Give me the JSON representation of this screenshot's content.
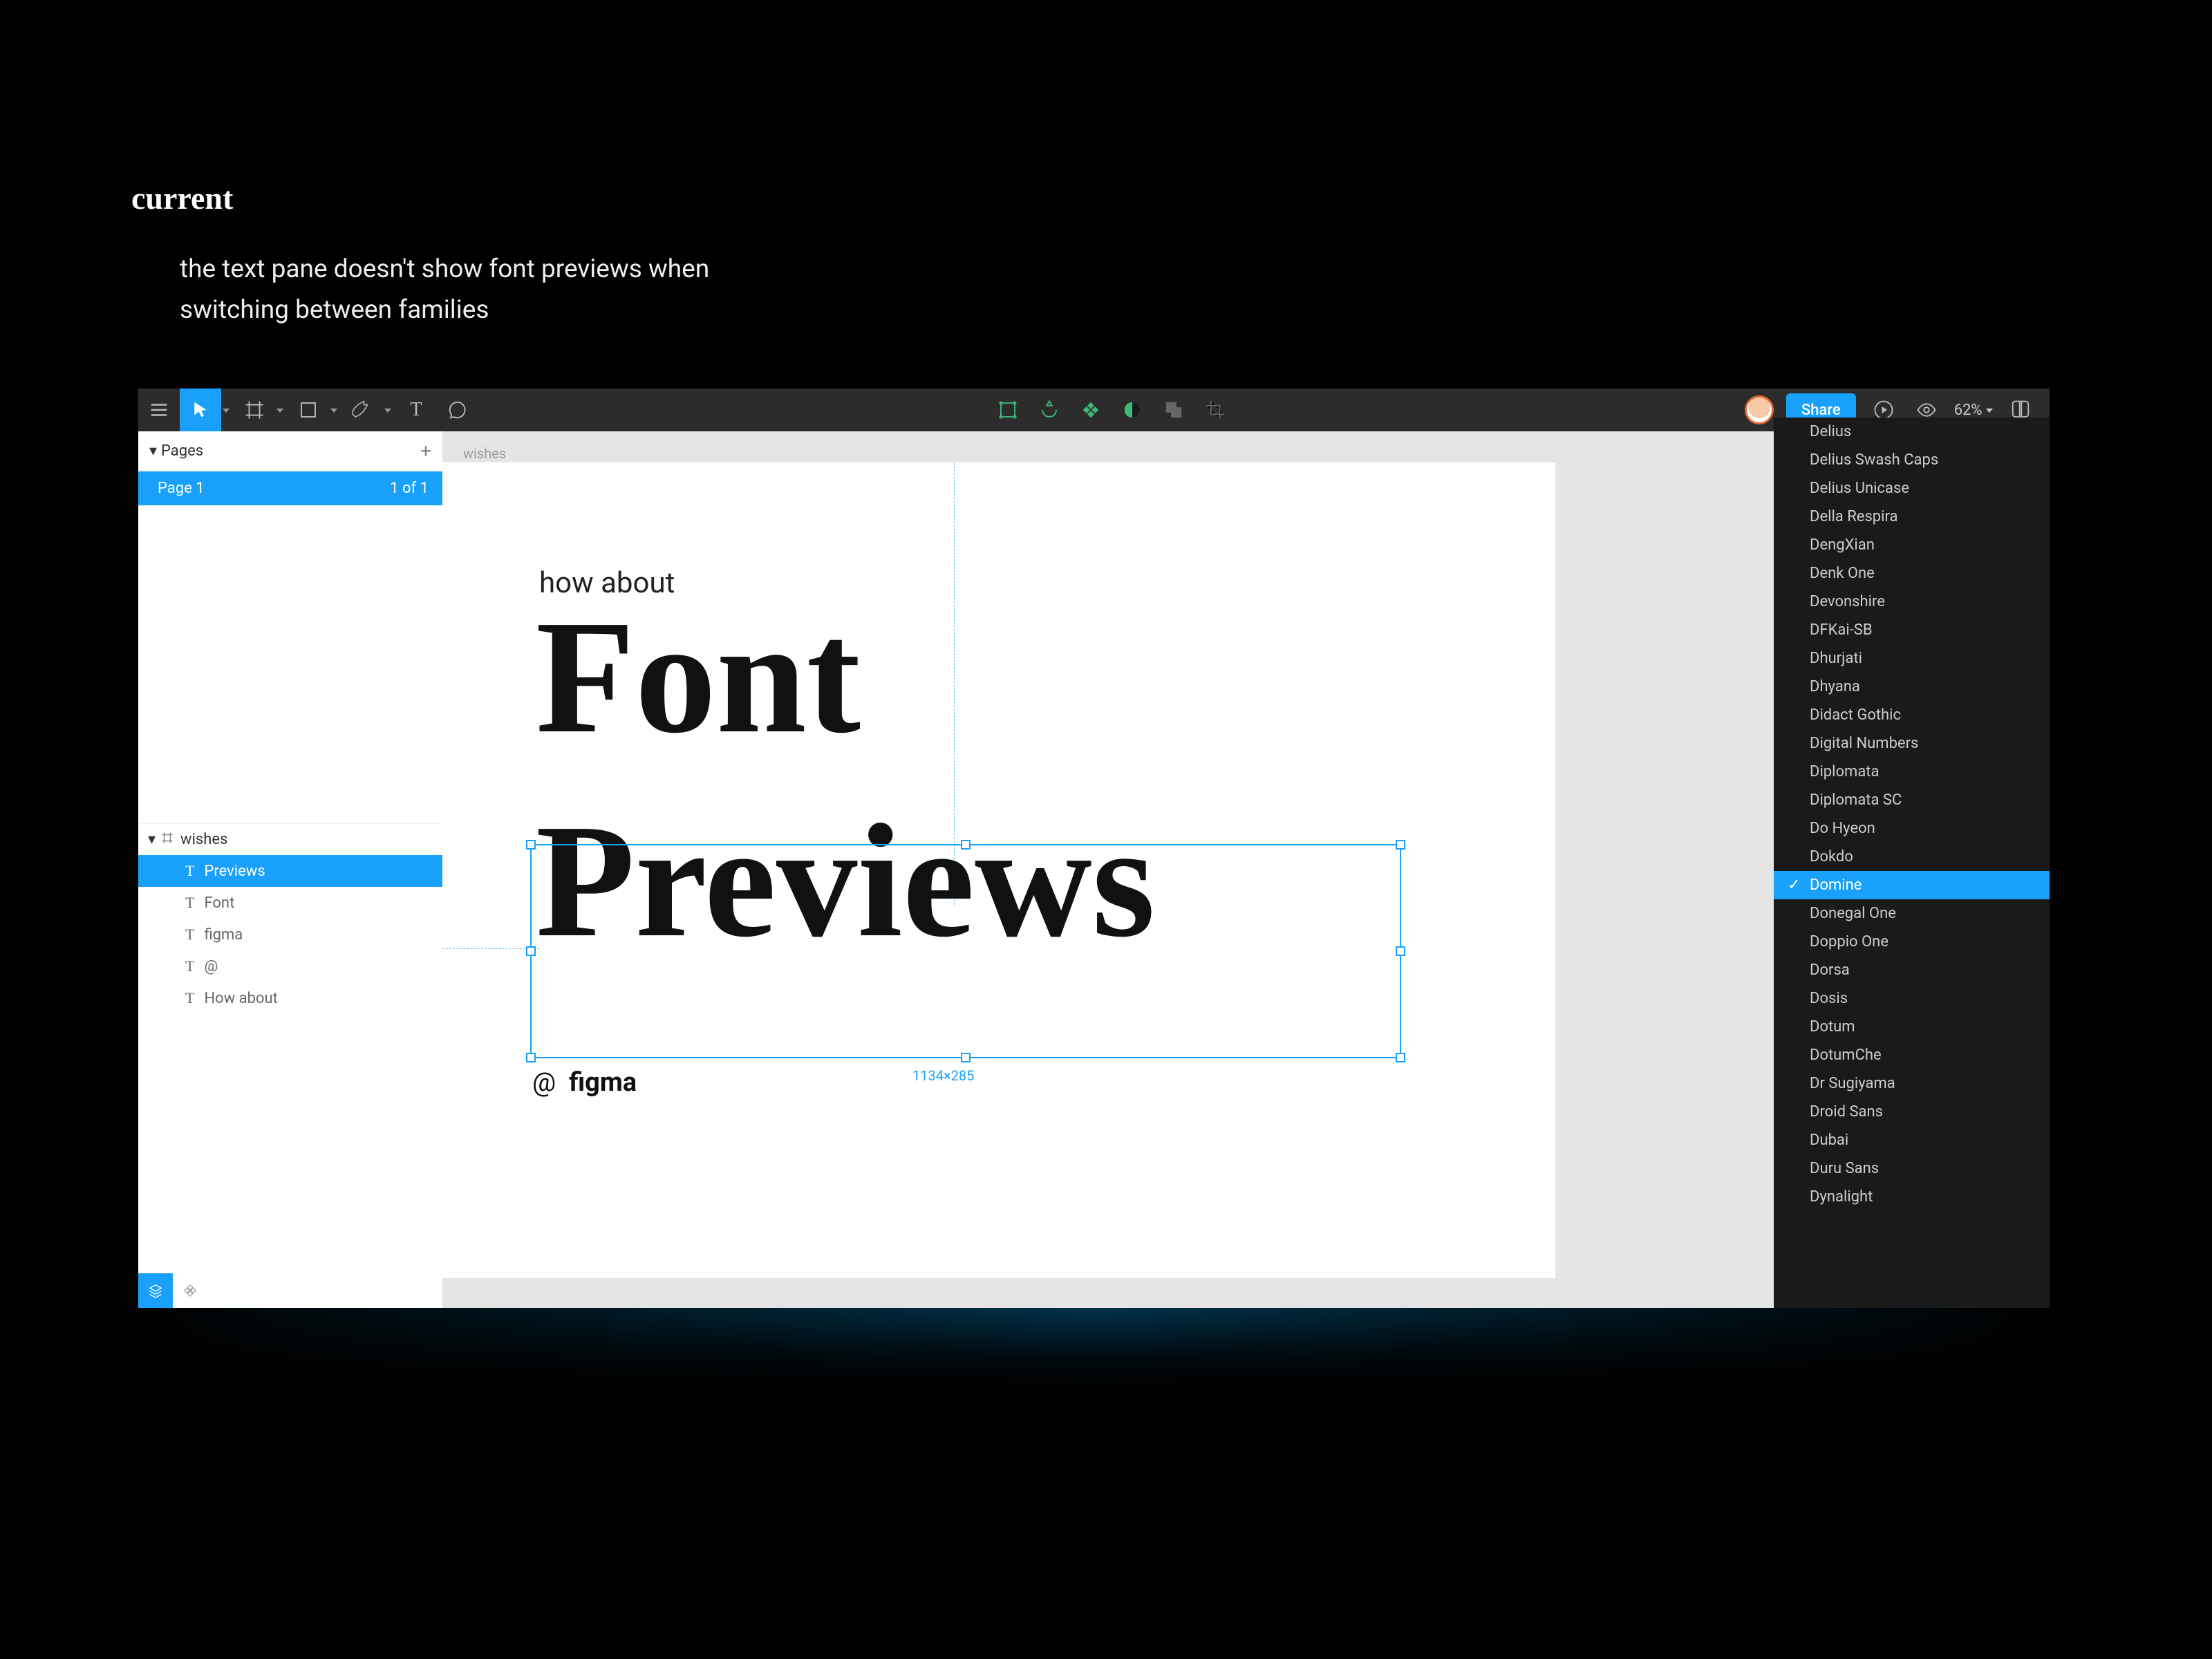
{
  "slide": {
    "title": "current",
    "description_line1": "the text pane doesn't show font previews when",
    "description_line2": "switching between families"
  },
  "toolbar": {
    "share_label": "Share",
    "zoom": "62%"
  },
  "pages": {
    "header": "Pages",
    "page_name": "Page 1",
    "page_count": "1 of 1"
  },
  "layers": {
    "frame_name": "wishes",
    "items": [
      {
        "label": "Previews"
      },
      {
        "label": "Font"
      },
      {
        "label": "figma"
      },
      {
        "label": "@"
      },
      {
        "label": "How about"
      }
    ]
  },
  "canvas": {
    "frame_label": "wishes",
    "text_howabout": "how about",
    "text_font": "Font",
    "text_previews": "Previews",
    "text_at": "@",
    "text_figma": "figma",
    "selection_dims": "1134×285"
  },
  "font_dropdown": {
    "selected": "Domine",
    "items": [
      "Delius",
      "Delius Swash Caps",
      "Delius Unicase",
      "Della Respira",
      "DengXian",
      "Denk One",
      "Devonshire",
      "DFKai-SB",
      "Dhurjati",
      "Dhyana",
      "Didact Gothic",
      "Digital Numbers",
      "Diplomata",
      "Diplomata SC",
      "Do Hyeon",
      "Dokdo",
      "Domine",
      "Donegal One",
      "Doppio One",
      "Dorsa",
      "Dosis",
      "Dotum",
      "DotumChe",
      "Dr Sugiyama",
      "Droid Sans",
      "Dubai",
      "Duru Sans",
      "Dynalight"
    ]
  }
}
